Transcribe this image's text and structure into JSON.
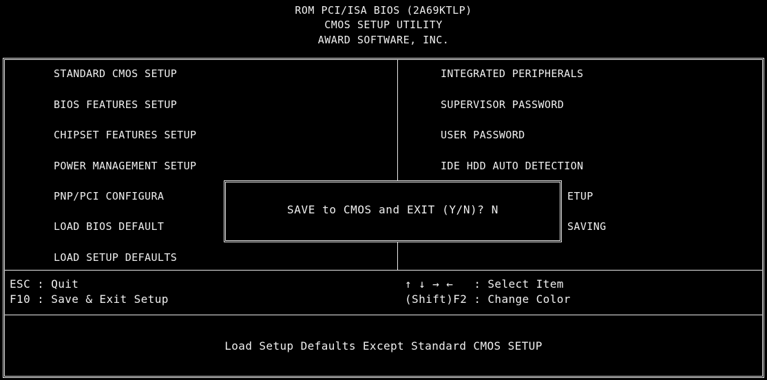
{
  "header": {
    "line1": "ROM PCI/ISA BIOS (2A69KTLP)",
    "line2": "CMOS SETUP UTILITY",
    "line3": "AWARD SOFTWARE, INC."
  },
  "menu": {
    "left": [
      "STANDARD CMOS SETUP",
      "BIOS FEATURES SETUP",
      "CHIPSET FEATURES SETUP",
      "POWER MANAGEMENT SETUP",
      "PNP/PCI CONFIGURA",
      "LOAD BIOS DEFAULT",
      "LOAD SETUP DEFAULTS"
    ],
    "right": [
      "INTEGRATED PERIPHERALS",
      "SUPERVISOR PASSWORD",
      "USER PASSWORD",
      "IDE HDD AUTO DETECTION",
      "ETUP",
      "SAVING"
    ]
  },
  "dialog": {
    "prompt": "SAVE to CMOS and EXIT (Y/N)? N"
  },
  "help": {
    "esc": "ESC : Quit",
    "f10": "F10 : Save & Exit Setup",
    "select": "↑ ↓ → ←   : Select Item",
    "color": "(Shift)F2 : Change Color"
  },
  "status": {
    "description": "Load Setup Defaults Except Standard CMOS SETUP"
  },
  "colors": {
    "background": "#000000",
    "foreground": "#f0f0f0",
    "frame": "#ececec"
  }
}
